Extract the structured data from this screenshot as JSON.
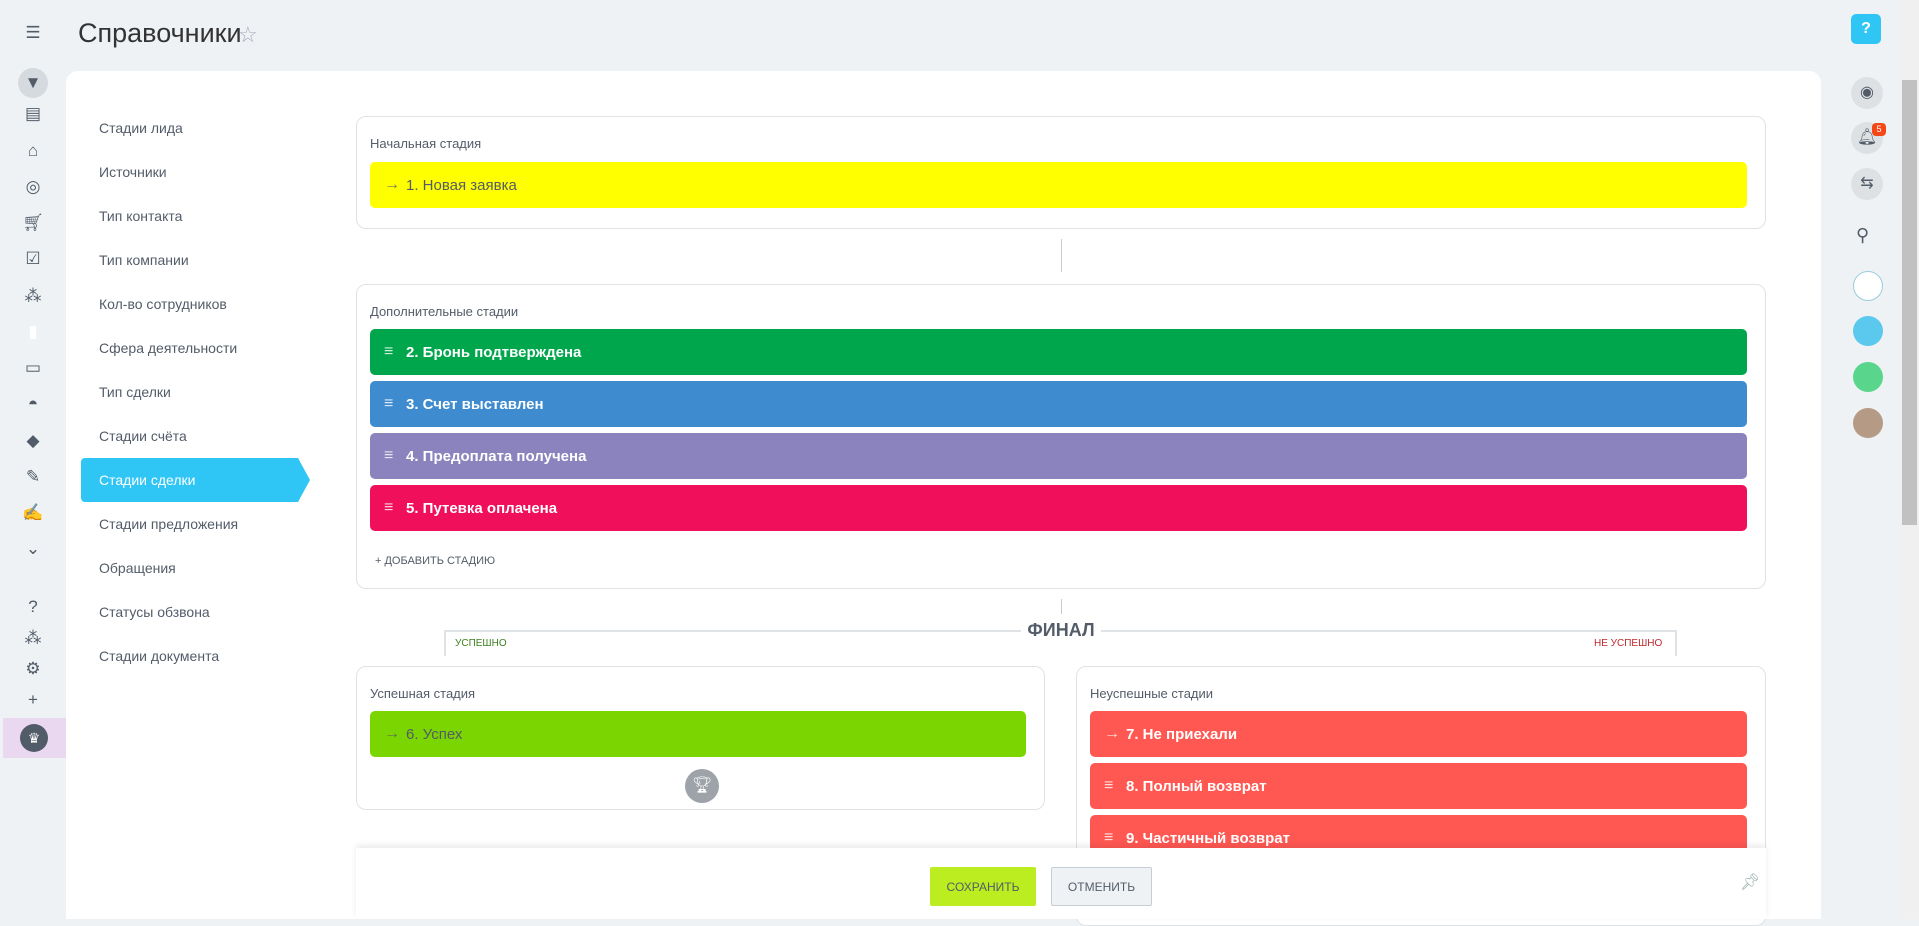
{
  "header": {
    "title": "Справочники"
  },
  "leftbar": {
    "icons": [
      "menu-icon",
      "funnel-icon",
      "tasks-icon",
      "store-icon",
      "target-icon",
      "cart-icon",
      "checkbox-icon",
      "network-icon",
      "chart-icon",
      "contact-card-icon",
      "robot-icon",
      "box-icon",
      "document-edit-icon",
      "signature-icon",
      "more-icon",
      "help-icon",
      "hierarchy-icon",
      "gear-icon",
      "plus-icon",
      "crown-icon"
    ]
  },
  "menu": {
    "items": [
      "Стадии лида",
      "Источники",
      "Тип контакта",
      "Тип компании",
      "Кол-во сотрудников",
      "Сфера деятельности",
      "Тип сделки",
      "Стадии счёта",
      "Стадии сделки",
      "Стадии предложения",
      "Обращения",
      "Статусы обзвона",
      "Стадии документа"
    ],
    "active_index": 8
  },
  "start": {
    "label": "Начальная стадия",
    "stage": "1. Новая заявка",
    "color": "#ffff00"
  },
  "additional": {
    "label": "Дополнительные стадии",
    "stages": [
      {
        "name": "2. Бронь подтверждена",
        "color": "#00a64c"
      },
      {
        "name": "3. Счет выставлен",
        "color": "#3e8bd0"
      },
      {
        "name": "4. Предоплата получена",
        "color": "#8a83be"
      },
      {
        "name": "5. Путевка оплачена",
        "color": "#ef0f5a"
      }
    ],
    "add_label": "+ ДОБАВИТЬ СТАДИЮ"
  },
  "final": {
    "title": "ФИНАЛ",
    "success_label": "УСПЕШНО",
    "fail_label": "НЕ УСПЕШНО"
  },
  "success": {
    "label": "Успешная стадия",
    "stage": "6. Успех",
    "color": "#7bd500"
  },
  "fail": {
    "label": "Неуспешные стадии",
    "stages": [
      "7. Не приехали",
      "8. Полный возврат",
      "9. Частичный возврат"
    ],
    "color": "#ff5752"
  },
  "footer": {
    "save": "СОХРАНИТЬ",
    "cancel": "ОТМЕНИТЬ"
  },
  "rightbar": {
    "notifications_count": "5"
  }
}
